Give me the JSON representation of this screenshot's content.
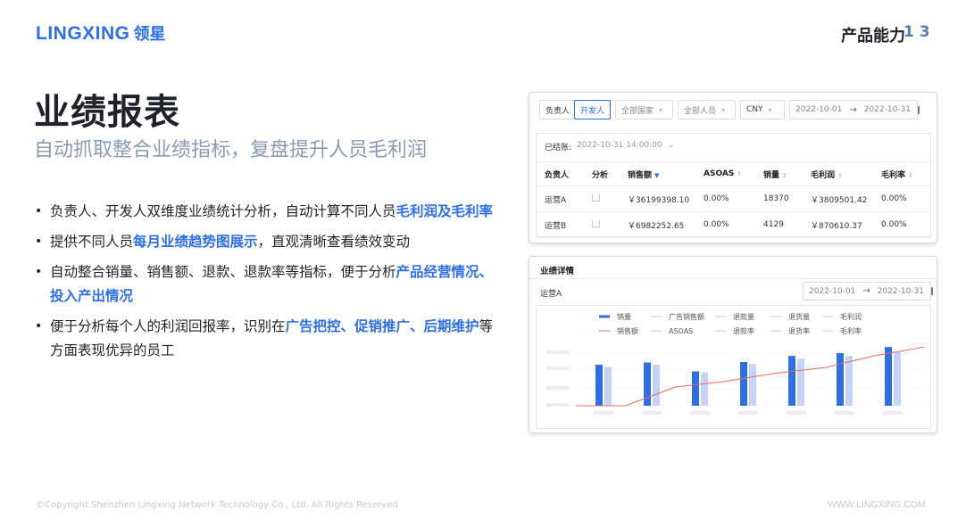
{
  "header": {
    "logo_latin": "LINGXING",
    "logo_cn": "领星",
    "section_title": "产品能力",
    "page_num": "1 3"
  },
  "main": {
    "title": "业绩报表",
    "subtitle": "自动抓取整合业绩指标，复盘提升人员毛利润"
  },
  "bullets": [
    {
      "pre": "负责人、开发人双维度业绩统计分析，自动计算不同人员",
      "hl": "毛利润及毛利率",
      "post": ""
    },
    {
      "pre": "提供不同人员",
      "hl": "每月业绩趋势图展示",
      "post": "，直观清晰查看绩效变动"
    },
    {
      "pre": "自动整合销量、销售额、退款、退款率等指标，便于分析",
      "hl": "产品经营情况、投入产出情况",
      "post": ""
    },
    {
      "pre": "便于分析每个人的利润回报率，识别在",
      "hl": "广告把控、促销推广、后期维护",
      "post": "等方面表现优异的员工"
    }
  ],
  "footer": {
    "copyright": "©Copyright Shenzhen Lingxing Network Technology Co., Ltd. All Rights Reserved",
    "url": "WWW.LINGXING.COM"
  },
  "report_panel": {
    "seg_owner": "负责人",
    "seg_dev": "开发人",
    "country_select": "全部国家",
    "staff_select": "全部人员",
    "currency_select": "CNY",
    "date_start": "2022-10-01",
    "date_end": "2022-10-31",
    "settled_label": "已结账:",
    "settled_value": "2022-10-31  14:00:00",
    "columns": [
      "负责人",
      "分析",
      "销售额",
      "ASOAS",
      "销量",
      "毛利润",
      "毛利率"
    ],
    "rows": [
      {
        "owner": "运营A",
        "sales": "￥36199398.10",
        "asoas": "0.00%",
        "qty": "18370",
        "profit": "￥3809501.42",
        "margin": "0.00%"
      },
      {
        "owner": "运营B",
        "sales": "￥6982252.65",
        "asoas": "0.00%",
        "qty": "4129",
        "profit": "￥870610.37",
        "margin": "0.00%"
      }
    ]
  },
  "detail_panel": {
    "title": "业绩详情",
    "person": "运营A",
    "date_start": "2022-10-01",
    "date_end": "2022-10-31"
  },
  "colors": {
    "brand_blue": "#2f6fe4",
    "bar_primary": "#2f6fe4",
    "bar_secondary": "#c4d3f7",
    "line_red": "#e86a5f"
  },
  "chart_data": {
    "type": "bar",
    "legend": [
      [
        "销量",
        "广告销售额",
        "退款量",
        "退货量",
        "毛利润"
      ],
      [
        "销售额",
        "ASOAS",
        "退款率",
        "退货率",
        "毛利率"
      ]
    ],
    "series": [
      {
        "name": "销量",
        "type": "bar",
        "values": [
          0.58,
          0.62,
          0.46,
          0.63,
          0.74,
          0.79,
          0.9
        ]
      },
      {
        "name": "广告销售额",
        "type": "bar",
        "values": [
          0.54,
          0.58,
          0.44,
          0.59,
          0.69,
          0.74,
          0.81
        ]
      },
      {
        "name": "销售额",
        "type": "line",
        "values": [
          0.0,
          0.0,
          0.3,
          0.39,
          0.52,
          0.61,
          0.8,
          0.94
        ]
      }
    ]
  }
}
